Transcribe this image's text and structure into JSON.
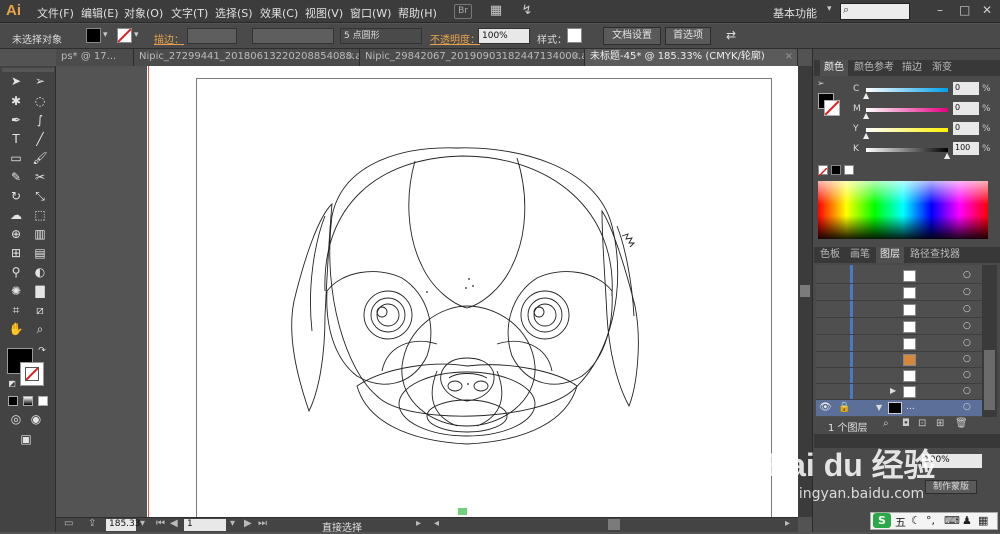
{
  "app": {
    "logo": "Ai"
  },
  "menu": [
    "文件(F)",
    "编辑(E)",
    "对象(O)",
    "文字(T)",
    "选择(S)",
    "效果(C)",
    "视图(V)",
    "窗口(W)",
    "帮助(H)"
  ],
  "menubar_icons": {
    "bridge": "Br"
  },
  "workspace": "基本功能",
  "window_buttons": [
    "–",
    "□",
    "✕"
  ],
  "control": {
    "selection": "未选择对象",
    "stroke_label": "描边：",
    "brush": "5 点圆形",
    "opacity_label": "不透明度：",
    "opacity_value": "100%",
    "style_label": "样式：",
    "doc_setup": "文档设置",
    "preferences": "首选项"
  },
  "tabs": [
    "ps* @ 17...",
    "Nipic_27299441_20180613220208854088.ai*",
    "Nipic_29842067_20190903182447134000.ai*",
    "未标题-45* @ 185.33% (CMYK/轮廓)"
  ],
  "tools_icons": [
    "selection-icon",
    "direct-selection-icon",
    "magic-wand-icon",
    "lasso-icon",
    "pen-icon",
    "curvature-icon",
    "type-icon",
    "line-icon",
    "rectangle-icon",
    "paintbrush-icon",
    "pencil-icon",
    "scissors-icon",
    "rotate-icon",
    "scale-icon",
    "warp-icon",
    "free-transform-icon",
    "shape-builder-icon",
    "perspective-icon",
    "mesh-icon",
    "gradient-icon",
    "eyedropper-icon",
    "blend-icon",
    "symbol-sprayer-icon",
    "graph-icon",
    "artboard-icon",
    "slice-icon",
    "hand-icon",
    "zoom-icon"
  ],
  "status": {
    "zoom": "185.33",
    "page": "1",
    "tool": "直接选择"
  },
  "color_panel": {
    "tabs": [
      "颜色",
      "颜色参考",
      "描边",
      "渐变"
    ],
    "sliders": [
      {
        "label": "C",
        "value": "0"
      },
      {
        "label": "M",
        "value": "0"
      },
      {
        "label": "Y",
        "value": "0"
      },
      {
        "label": "K",
        "value": "100"
      }
    ],
    "unit": "%"
  },
  "layers_panel": {
    "tabs": [
      "色板",
      "画笔",
      "图层",
      "路径查找器"
    ],
    "count_label": "1 个图层",
    "selected_layer_name": "..."
  },
  "hidden_panel": {
    "opacity_value": "100%",
    "make_mask": "制作蒙版"
  },
  "watermark": {
    "brand": "Bai du 经验",
    "url": "jingyan.baidu.com"
  },
  "ime": {
    "s_label": "S",
    "mode": "五"
  }
}
